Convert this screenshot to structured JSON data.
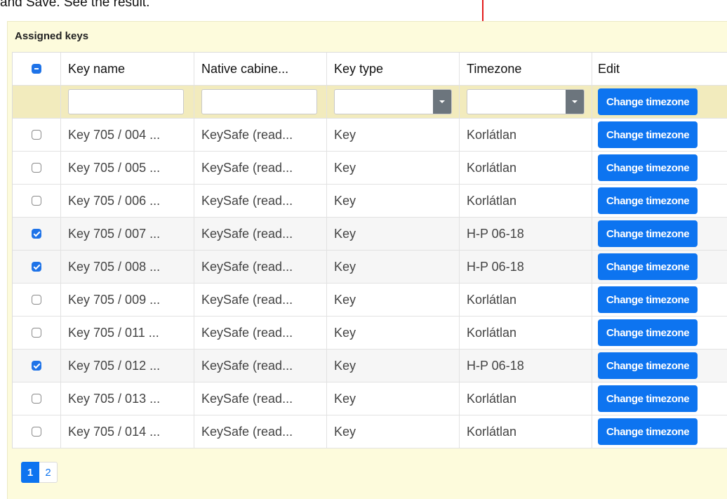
{
  "caption": "and Save. See the result.",
  "panel_title": "Assigned keys",
  "table": {
    "headers": {
      "key_name": "Key name",
      "native_cabinet": "Native cabine...",
      "key_type": "Key type",
      "timezone": "Timezone",
      "edit": "Edit"
    },
    "filter_button_label": "Change timezone",
    "rows": [
      {
        "key_name": "Key 705 / 004 ...",
        "native_cabinet": "KeySafe (read...",
        "key_type": "Key",
        "timezone": "Korlátlan",
        "checked": false,
        "button": "Change timezone"
      },
      {
        "key_name": "Key 705 / 005 ...",
        "native_cabinet": "KeySafe (read...",
        "key_type": "Key",
        "timezone": "Korlátlan",
        "checked": false,
        "button": "Change timezone"
      },
      {
        "key_name": "Key 705 / 006 ...",
        "native_cabinet": "KeySafe (read...",
        "key_type": "Key",
        "timezone": "Korlátlan",
        "checked": false,
        "button": "Change timezone"
      },
      {
        "key_name": "Key 705 / 007 ...",
        "native_cabinet": "KeySafe (read...",
        "key_type": "Key",
        "timezone": "H-P 06-18",
        "checked": true,
        "button": "Change timezone"
      },
      {
        "key_name": "Key 705 / 008 ...",
        "native_cabinet": "KeySafe (read...",
        "key_type": "Key",
        "timezone": "H-P 06-18",
        "checked": true,
        "button": "Change timezone"
      },
      {
        "key_name": "Key 705 / 009 ...",
        "native_cabinet": "KeySafe (read...",
        "key_type": "Key",
        "timezone": "Korlátlan",
        "checked": false,
        "button": "Change timezone"
      },
      {
        "key_name": "Key 705 / 011 ...",
        "native_cabinet": "KeySafe (read...",
        "key_type": "Key",
        "timezone": "Korlátlan",
        "checked": false,
        "button": "Change timezone"
      },
      {
        "key_name": "Key 705 / 012 ...",
        "native_cabinet": "KeySafe (read...",
        "key_type": "Key",
        "timezone": "H-P 06-18",
        "checked": true,
        "button": "Change timezone"
      },
      {
        "key_name": "Key 705 / 013 ...",
        "native_cabinet": "KeySafe (read...",
        "key_type": "Key",
        "timezone": "Korlátlan",
        "checked": false,
        "button": "Change timezone"
      },
      {
        "key_name": "Key 705 / 014 ...",
        "native_cabinet": "KeySafe (read...",
        "key_type": "Key",
        "timezone": "Korlátlan",
        "checked": false,
        "button": "Change timezone"
      }
    ]
  },
  "pagination": {
    "pages": [
      "1",
      "2"
    ],
    "current": "1"
  },
  "colors": {
    "accent": "#0d74f0",
    "annotation_arrow": "#e31b1b",
    "panel_background": "#fdfbdc",
    "filter_row_background": "#f2ebbd"
  }
}
